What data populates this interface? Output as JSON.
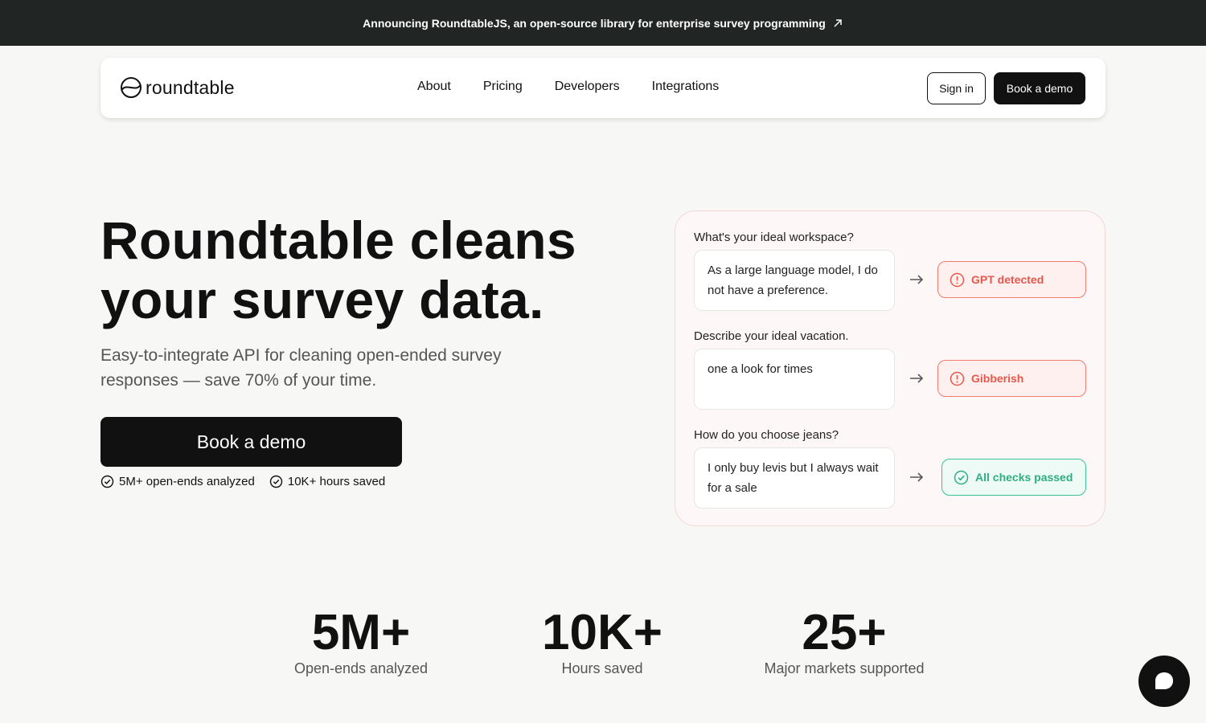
{
  "announcement": {
    "text": "Announcing RoundtableJS, an open-source library for enterprise survey programming",
    "icon": "external-arrow-icon"
  },
  "nav": {
    "logo_text": "roundtable",
    "links": [
      "About",
      "Pricing",
      "Developers",
      "Integrations"
    ],
    "sign_in": "Sign in",
    "book_demo": "Book a demo"
  },
  "hero": {
    "title_line1": "Roundtable cleans",
    "title_line2": "your survey data.",
    "subtitle": "Easy-to-integrate API for cleaning open-ended survey responses — save 70% of your time.",
    "cta": "Book a demo",
    "checks": [
      "5M+ open-ends analyzed",
      "10K+ hours saved"
    ]
  },
  "examples": [
    {
      "question": "What's your ideal workspace?",
      "answer": "As a large language model, I do not have a preference.",
      "result": "GPT detected",
      "status": "warn"
    },
    {
      "question": "Describe your ideal vacation.",
      "answer": "one a look for times",
      "result": "Gibberish",
      "status": "warn"
    },
    {
      "question": "How do you choose jeans?",
      "answer": "I only buy levis but I always wait for a sale",
      "result": "All checks passed",
      "status": "ok"
    }
  ],
  "stats": [
    {
      "value": "5M+",
      "label": "Open-ends analyzed"
    },
    {
      "value": "10K+",
      "label": "Hours saved"
    },
    {
      "value": "25+",
      "label": "Major markets supported"
    }
  ],
  "colors": {
    "warn": "#e8574b",
    "ok": "#2fae81",
    "dark": "#111111",
    "banner": "#212524"
  }
}
